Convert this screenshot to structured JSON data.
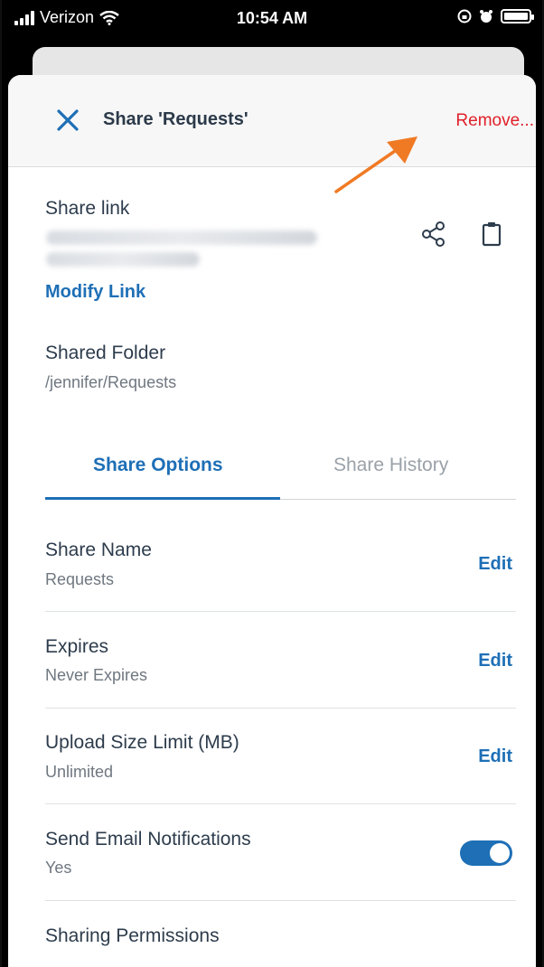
{
  "status_bar": {
    "carrier": "Verizon",
    "time": "10:54 AM"
  },
  "header": {
    "title": "Share 'Requests'",
    "remove_label": "Remove..."
  },
  "share_link": {
    "label": "Share link",
    "modify_label": "Modify Link"
  },
  "shared_folder": {
    "label": "Shared Folder",
    "path": "/jennifer/Requests"
  },
  "tabs": [
    {
      "label": "Share Options",
      "active": true
    },
    {
      "label": "Share History",
      "active": false
    }
  ],
  "options": {
    "share_name": {
      "label": "Share Name",
      "value": "Requests",
      "action": "Edit"
    },
    "expires": {
      "label": "Expires",
      "value": "Never Expires",
      "action": "Edit"
    },
    "upload_limit": {
      "label": "Upload Size Limit (MB)",
      "value": "Unlimited",
      "action": "Edit"
    },
    "email_notifications": {
      "label": "Send Email Notifications",
      "value": "Yes",
      "enabled": true
    },
    "sharing_permissions": {
      "label": "Sharing Permissions"
    }
  },
  "colors": {
    "accent": "#1e6fb6",
    "remove": "#e0202a",
    "annotation_arrow": "#f07a24"
  },
  "icons": [
    "close-icon",
    "share-icon",
    "clipboard-icon",
    "wifi-icon",
    "alarm-icon",
    "battery-icon"
  ]
}
